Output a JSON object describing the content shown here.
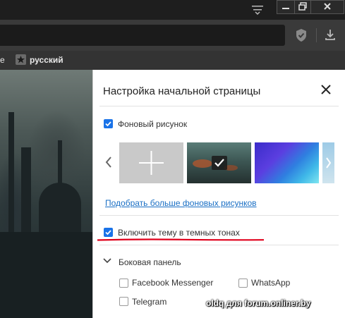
{
  "bookmarks_bar": {
    "prefix": "е",
    "items": [
      {
        "label": "русский",
        "icon": "star-icon"
      }
    ]
  },
  "settings_panel": {
    "title": "Настройка начальной страницы",
    "background_checkbox": {
      "label": "Фоновый рисунок",
      "checked": true
    },
    "more_backgrounds_link": "Подобрать больше фоновых рисунков",
    "dark_theme_checkbox": {
      "label": "Включить тему в темных тонах",
      "checked": true
    },
    "sidebar_section": {
      "label": "Боковая панель",
      "items": [
        {
          "label": "Facebook Messenger",
          "checked": false
        },
        {
          "label": "WhatsApp",
          "checked": false
        },
        {
          "label": "Telegram",
          "checked": false
        }
      ]
    }
  },
  "watermark": "oldq для forum.onliner.by",
  "colors": {
    "accent": "#1a73e8",
    "link": "#1a6fc4",
    "annotation": "#e0001b"
  }
}
